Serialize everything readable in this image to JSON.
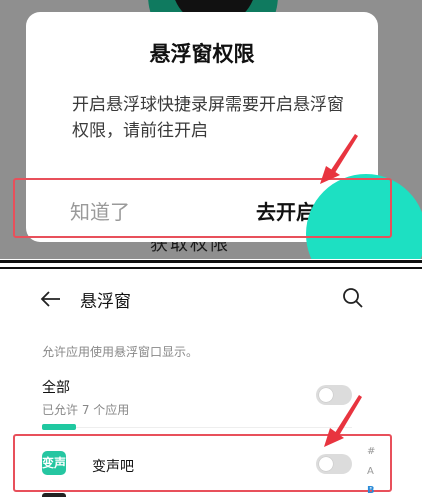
{
  "dialog": {
    "title": "悬浮窗权限",
    "message": "开启悬浮球快捷录屏需要开启悬浮窗权限，请前往开启",
    "dismiss_label": "知道了",
    "open_label": "去开启",
    "background_partial_text": "获取权限"
  },
  "settings": {
    "title": "悬浮窗",
    "description": "允许应用使用悬浮窗口显示。",
    "all_label": "全部",
    "all_sub": "已允许 7 个应用",
    "app_name": "变声吧",
    "app_icon_text": "变声",
    "index_letters": [
      "#",
      "A",
      "B"
    ]
  },
  "colors": {
    "accent_teal": "#1de0c2",
    "highlight_red": "#e8505b",
    "dim_overlay": "#8f8f8f"
  },
  "icons": [
    "back-arrow-icon",
    "search-icon",
    "red-arrow-icon",
    "app-icon"
  ]
}
